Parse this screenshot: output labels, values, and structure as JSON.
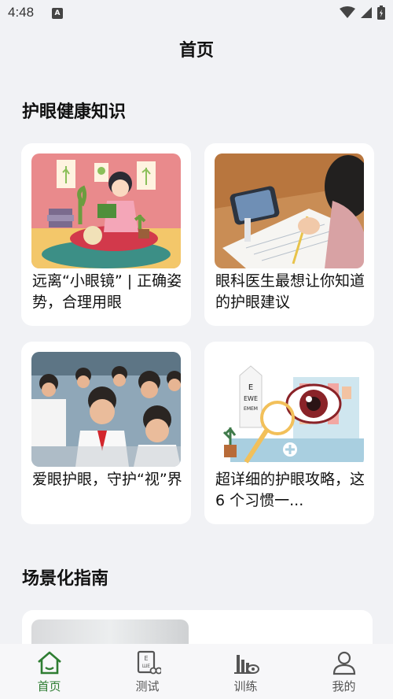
{
  "status": {
    "time": "4:48",
    "notification": "A"
  },
  "header": {
    "title": "首页"
  },
  "sections": {
    "knowledge": "护眼健康知识",
    "scenes": "场景化指南"
  },
  "articles": [
    {
      "title": "远离“小眼镜” | 正确姿势，合理用眼",
      "image": "girl-reading-illustration"
    },
    {
      "title": "眼科医生最想让你知道的护眼建议",
      "image": "child-writing-with-phone-photo"
    },
    {
      "title": "爱眼护眼，守护“视”界",
      "image": "students-eye-exercise-photo"
    },
    {
      "title": "超详细的护眼攻略，这 6 个习惯一...",
      "image": "eye-chart-magnifier-illustration"
    }
  ],
  "tabs": [
    {
      "label": "首页",
      "icon": "home-icon",
      "active": true
    },
    {
      "label": "测试",
      "icon": "eye-chart-icon",
      "active": false
    },
    {
      "label": "训练",
      "icon": "training-icon",
      "active": false
    },
    {
      "label": "我的",
      "icon": "user-icon",
      "active": false
    }
  ],
  "colors": {
    "accent": "#2e7d32",
    "background": "#f1f2f5",
    "card": "#ffffff"
  }
}
